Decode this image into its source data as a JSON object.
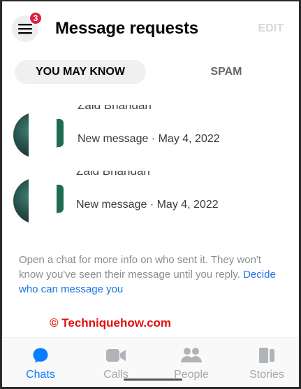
{
  "header": {
    "title": "Message requests",
    "edit_label": "EDIT",
    "menu_badge_count": "3"
  },
  "tabs": [
    {
      "label": "YOU MAY KNOW",
      "active": true
    },
    {
      "label": "SPAM",
      "active": false
    }
  ],
  "requests": [
    {
      "name": "Zaid Bhandari",
      "meta": "New message · May 4, 2022"
    },
    {
      "name": "Zaid Bhandari",
      "meta": "New message · May 4, 2022"
    }
  ],
  "info": {
    "text": "Open a chat for more info on who sent it. They won't know you've seen their message until you reply.",
    "link": "Decide who can message you"
  },
  "watermark": "© Techniquehow.com",
  "bottom_nav": [
    {
      "label": "Chats",
      "icon": "chat-bubble-icon",
      "active": true
    },
    {
      "label": "Calls",
      "icon": "video-camera-icon",
      "active": false
    },
    {
      "label": "People",
      "icon": "people-icon",
      "active": false
    },
    {
      "label": "Stories",
      "icon": "stories-icon",
      "active": false
    }
  ],
  "colors": {
    "accent": "#0a7cff",
    "link": "#1b74e4",
    "badge": "#e41e3f",
    "watermark": "#e01010",
    "inactive": "#a5a7ab"
  }
}
